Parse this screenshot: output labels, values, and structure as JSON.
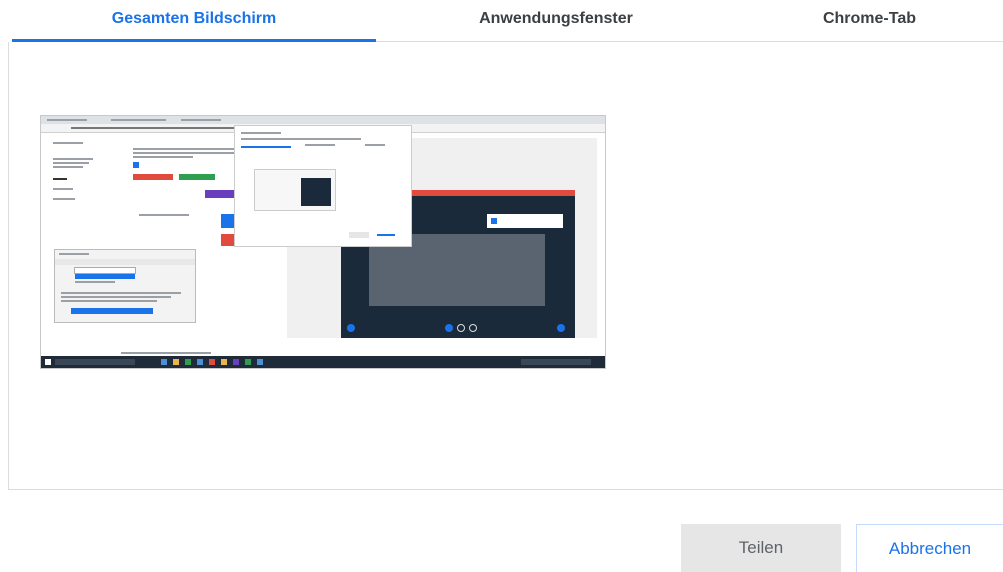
{
  "tabs": [
    {
      "label": "Gesamten Bildschirm",
      "active": true
    },
    {
      "label": "Anwendungsfenster",
      "active": false
    },
    {
      "label": "Chrome-Tab",
      "active": false
    }
  ],
  "preview": {
    "selected": true
  },
  "buttons": {
    "share_label": "Teilen",
    "cancel_label": "Abbrechen"
  },
  "colors": {
    "accent": "#1a73e8",
    "disabled_button": "#e6e6e6",
    "preview_dark": "#1b2a3a",
    "preview_red": "#e04b3e"
  }
}
